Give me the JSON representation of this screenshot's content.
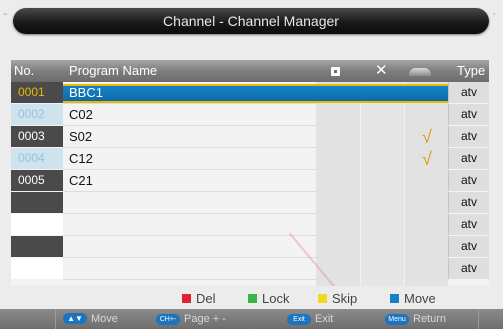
{
  "title": "Channel - Channel Manager",
  "columns": {
    "no": "No.",
    "name": "Program Name",
    "lock_icon": "lock-icon",
    "delete": "✕",
    "skip_icon": "skip-icon",
    "type": "Type"
  },
  "rows": [
    {
      "no": "0001",
      "name": "BBC1",
      "type": "atv",
      "selected": true,
      "skip": false
    },
    {
      "no": "0002",
      "name": "C02",
      "type": "atv",
      "selected": false,
      "skip": false
    },
    {
      "no": "0003",
      "name": "S02",
      "type": "atv",
      "selected": false,
      "skip": true
    },
    {
      "no": "0004",
      "name": "C12",
      "type": "atv",
      "selected": false,
      "skip": true
    },
    {
      "no": "0005",
      "name": "C21",
      "type": "atv",
      "selected": false,
      "skip": false
    },
    {
      "no": "",
      "name": "",
      "type": "atv",
      "selected": false,
      "skip": false
    },
    {
      "no": "",
      "name": "",
      "type": "atv",
      "selected": false,
      "skip": false
    },
    {
      "no": "",
      "name": "",
      "type": "atv",
      "selected": false,
      "skip": false
    },
    {
      "no": "",
      "name": "",
      "type": "atv",
      "selected": false,
      "skip": false
    }
  ],
  "check_mark": "√",
  "legend": {
    "del": "Del",
    "lock": "Lock",
    "skip": "Skip",
    "move": "Move"
  },
  "legend_colors": {
    "del": "#e0232b",
    "lock": "#37b54a",
    "skip": "#f2d81e",
    "move": "#1b7fc6"
  },
  "hints": {
    "move_key": "▲▼",
    "move": "Move",
    "page_key": "CH+-",
    "page": "Page + -",
    "exit_key": "Exit",
    "exit": "Exit",
    "menu_key": "Menu",
    "return": "Return"
  }
}
